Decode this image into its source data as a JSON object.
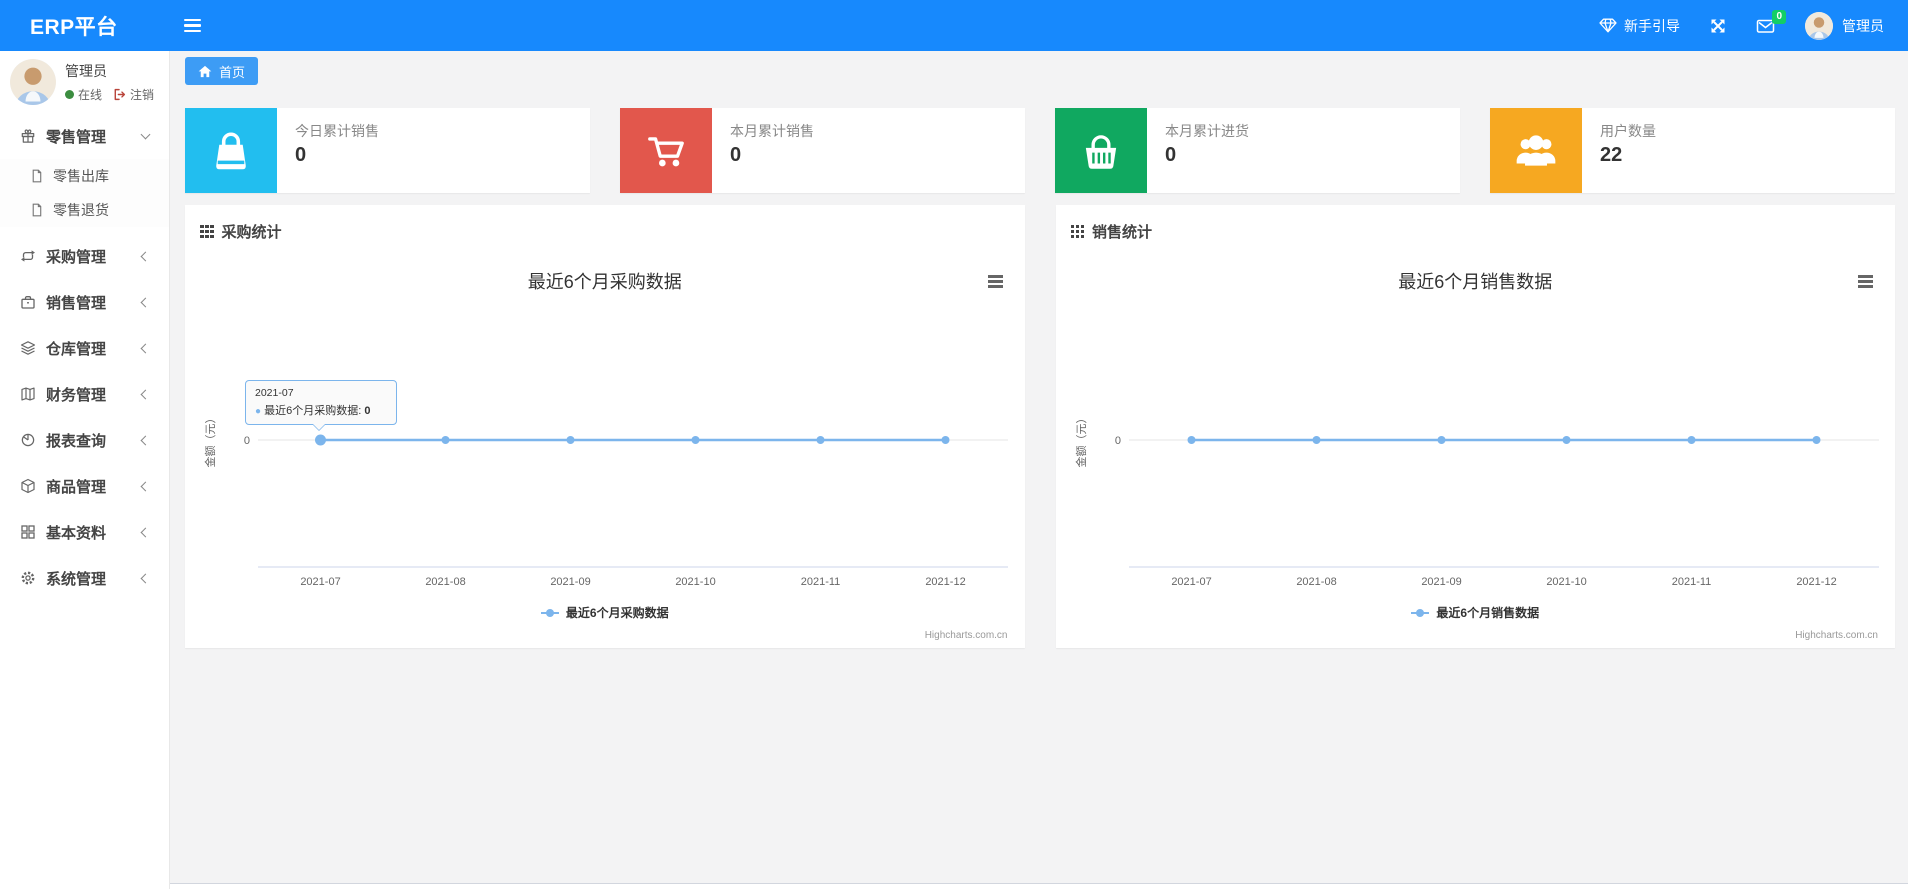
{
  "navbar": {
    "brand": "ERP平台",
    "guide_label": "新手引导",
    "messages_badge": "0",
    "user_name": "管理员"
  },
  "sidebar": {
    "user": {
      "name": "管理员",
      "status_label": "在线",
      "logout_label": "注销"
    },
    "menu": [
      {
        "label": "零售管理",
        "icon": "gift-icon",
        "expanded": true
      },
      {
        "label": "采购管理",
        "icon": "loop-icon",
        "expanded": false
      },
      {
        "label": "销售管理",
        "icon": "briefcase-icon",
        "expanded": false
      },
      {
        "label": "仓库管理",
        "icon": "layers-icon",
        "expanded": false
      },
      {
        "label": "财务管理",
        "icon": "book-icon",
        "expanded": false
      },
      {
        "label": "报表查询",
        "icon": "pie-chart-icon",
        "expanded": false
      },
      {
        "label": "商品管理",
        "icon": "cube-icon",
        "expanded": false
      },
      {
        "label": "基本资料",
        "icon": "grid-icon",
        "expanded": false
      },
      {
        "label": "系统管理",
        "icon": "gear-icon",
        "expanded": false
      }
    ],
    "submenu": [
      {
        "label": "零售出库",
        "icon": "file-icon"
      },
      {
        "label": "零售退货",
        "icon": "file-icon"
      }
    ]
  },
  "tab": {
    "label": "首页"
  },
  "stat_cards": [
    {
      "title": "今日累计销售",
      "value": "0",
      "icon": "shopping-bag-icon",
      "color": "#22beef"
    },
    {
      "title": "本月累计销售",
      "value": "0",
      "icon": "shopping-cart-icon",
      "color": "#e2574c"
    },
    {
      "title": "本月累计进货",
      "value": "0",
      "icon": "shopping-basket-icon",
      "color": "#10a860"
    },
    {
      "title": "用户数量",
      "value": "22",
      "icon": "users-icon",
      "color": "#f6a821"
    }
  ],
  "panels": [
    {
      "title": "采购统计"
    },
    {
      "title": "销售统计"
    }
  ],
  "chart_data": [
    {
      "type": "line",
      "title": "最近6个月采购数据",
      "categories": [
        "2021-07",
        "2021-08",
        "2021-09",
        "2021-10",
        "2021-11",
        "2021-12"
      ],
      "series": [
        {
          "name": "最近6个月采购数据",
          "values": [
            0,
            0,
            0,
            0,
            0,
            0
          ],
          "color": "#7cb5ec"
        }
      ],
      "ylabel": "金额（元）",
      "yticks": [
        "0"
      ],
      "ylim": [
        0,
        0
      ],
      "grid": true,
      "legend_position": "bottom",
      "credit": "Highcharts.com.cn",
      "tooltip": {
        "visible": true,
        "point_index": 0,
        "category": "2021-07",
        "label": "最近6个月采购数据:",
        "value": "0"
      }
    },
    {
      "type": "line",
      "title": "最近6个月销售数据",
      "categories": [
        "2021-07",
        "2021-08",
        "2021-09",
        "2021-10",
        "2021-11",
        "2021-12"
      ],
      "series": [
        {
          "name": "最近6个月销售数据",
          "values": [
            0,
            0,
            0,
            0,
            0,
            0
          ],
          "color": "#7cb5ec"
        }
      ],
      "ylabel": "金额（元）",
      "yticks": [
        "0"
      ],
      "ylim": [
        0,
        0
      ],
      "grid": true,
      "legend_position": "bottom",
      "credit": "Highcharts.com.cn",
      "tooltip": {
        "visible": false
      }
    }
  ]
}
